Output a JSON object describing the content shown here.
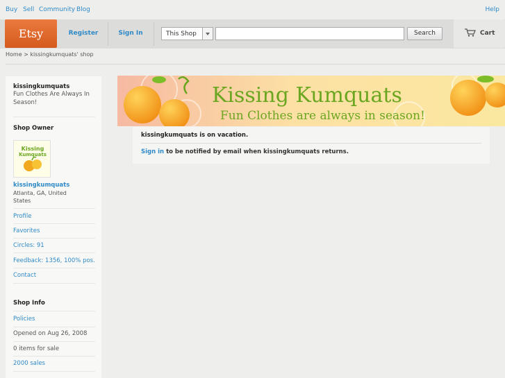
{
  "topnav": {
    "buy": "Buy",
    "sell": "Sell",
    "community": "Community",
    "blog": "Blog",
    "help": "Help"
  },
  "header": {
    "logo": "Etsy",
    "register": "Register",
    "sign_in": "Sign In",
    "search_scope": "This Shop",
    "search_placeholder": "",
    "search_button": "Search",
    "cart": "Cart"
  },
  "breadcrumb": "Home > kissingkumquats' shop",
  "sidebar": {
    "shop_name": "kissingkumquats",
    "tagline": "Fun Clothes Are Always In Season!",
    "owner_heading": "Shop Owner",
    "owner_name": "kissingkumquats",
    "location": "Atlanta, GA, United States",
    "links": [
      "Profile",
      "Favorites",
      "Circles: 91",
      "Feedback: 1356, 100% pos.",
      "Contact"
    ],
    "info_heading": "Shop Info",
    "policies": "Policies",
    "opened": "Opened on Aug 26, 2008",
    "items": "0 items for sale",
    "sales": "2000 sales"
  },
  "banner": {
    "title": "Kissing Kumquats",
    "subtitle": "Fun Clothes are always in season!"
  },
  "main": {
    "vacation": "kissingkumquats is on vacation.",
    "sign_in_link": "Sign in",
    "notify_text": " to be notified by email when kissingkumquats returns."
  },
  "colors": {
    "accent": "#2f8ac7",
    "etsy_orange": "#e16d30",
    "banner_green": "#6aa61f"
  },
  "icons": {
    "cart": "cart-icon"
  }
}
